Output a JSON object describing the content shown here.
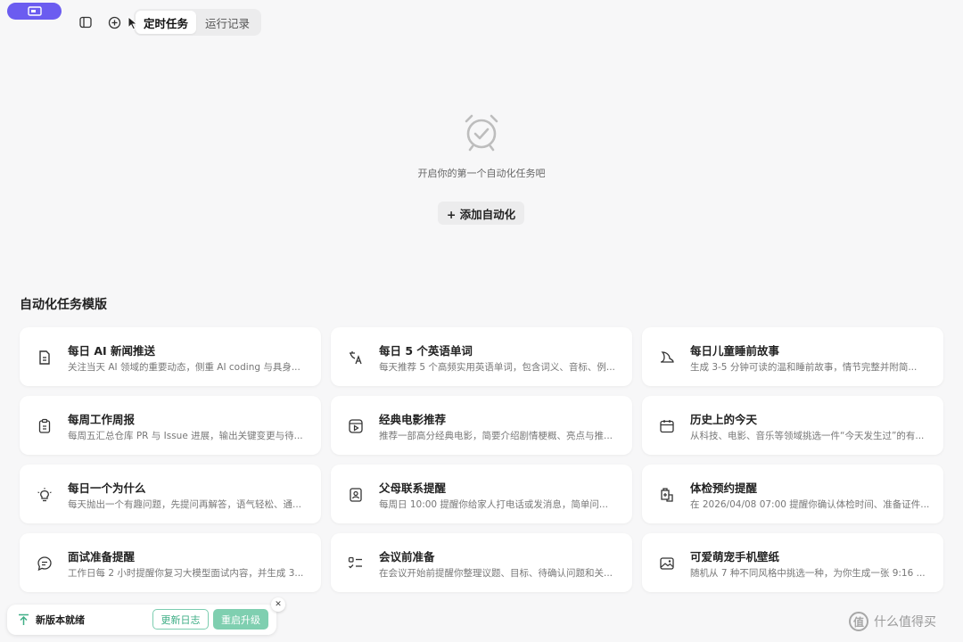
{
  "topbar": {
    "tabs": [
      {
        "label": "定时任务",
        "active": true
      },
      {
        "label": "运行记录",
        "active": false
      }
    ]
  },
  "empty_state": {
    "message": "开启你的第一个自动化任务吧",
    "add_button": "+ 添加自动化"
  },
  "templates": {
    "title": "自动化任务模版",
    "items": [
      {
        "icon": "news-icon",
        "title": "每日 AI 新闻推送",
        "desc": "关注当天 AI 领域的重要动态，侧重 AI coding 与具身..."
      },
      {
        "icon": "translate-icon",
        "title": "每日 5 个英语单词",
        "desc": "每天推荐 5 个高频实用英语单词，包含词义、音标、例..."
      },
      {
        "icon": "moon-icon",
        "title": "每日儿童睡前故事",
        "desc": "生成 3-5 分钟可读的温和睡前故事，情节完整并附简..."
      },
      {
        "icon": "clipboard-icon",
        "title": "每周工作周报",
        "desc": "每周五汇总仓库 PR 与 Issue 进展，输出关键变更与待..."
      },
      {
        "icon": "film-icon",
        "title": "经典电影推荐",
        "desc": "推荐一部高分经典电影，简要介绍剧情梗概、亮点与推..."
      },
      {
        "icon": "calendar-icon",
        "title": "历史上的今天",
        "desc": "从科技、电影、音乐等领域挑选一件“今天发生过”的有..."
      },
      {
        "icon": "lightbulb-icon",
        "title": "每日一个为什么",
        "desc": "每天抛出一个有趣问题，先提问再解答，语气轻松、通..."
      },
      {
        "icon": "contact-icon",
        "title": "父母联系提醒",
        "desc": "每周日 10:00 提醒你给家人打电话或发消息，简单问..."
      },
      {
        "icon": "health-icon",
        "title": "体检预约提醒",
        "desc": "在 2026/04/08 07:00 提醒你确认体检时间、准备证件..."
      },
      {
        "icon": "chat-icon",
        "title": "面试准备提醒",
        "desc": "工作日每 2 小时提醒你复习大模型面试内容，并生成 3..."
      },
      {
        "icon": "checklist-icon",
        "title": "会议前准备",
        "desc": "在会议开始前提醒你整理议题、目标、待确认问题和关..."
      },
      {
        "icon": "image-icon",
        "title": "可爱萌宠手机壁纸",
        "desc": "随机从 7 种不同风格中挑选一种，为你生成一张 9:16 ..."
      }
    ]
  },
  "update_bar": {
    "message": "新版本就绪",
    "log_button": "更新日志",
    "upgrade_button": "重启升级",
    "close_glyph": "✕"
  },
  "watermark": {
    "logo_glyph": "值",
    "text": "什么值得买"
  }
}
